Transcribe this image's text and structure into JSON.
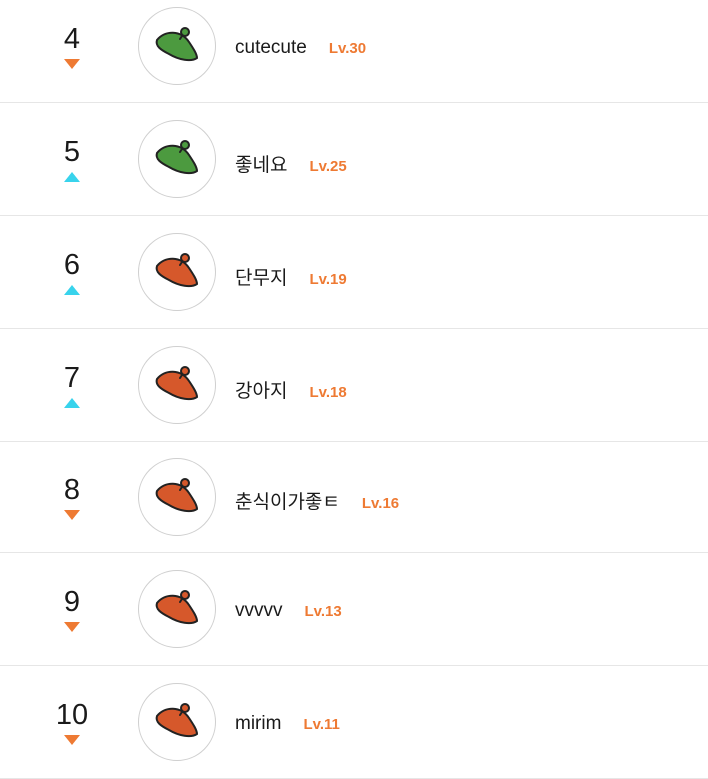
{
  "colors": {
    "down": "#ee7a33",
    "up": "#38d3ec",
    "level": "#ee7a33",
    "leaf_green": "#4c9a3f",
    "leaf_orange": "#d6582b"
  },
  "ranking": [
    {
      "rank": "4",
      "trend": "down",
      "name": "cutecute",
      "level": "Lv.30",
      "avatar_color": "green",
      "avatar_icon": "leaf-icon"
    },
    {
      "rank": "5",
      "trend": "up",
      "name": "좋네요",
      "level": "Lv.25",
      "avatar_color": "green",
      "avatar_icon": "leaf-icon"
    },
    {
      "rank": "6",
      "trend": "up",
      "name": "단무지",
      "level": "Lv.19",
      "avatar_color": "orange",
      "avatar_icon": "leaf-icon"
    },
    {
      "rank": "7",
      "trend": "up",
      "name": "강아지",
      "level": "Lv.18",
      "avatar_color": "orange",
      "avatar_icon": "leaf-icon"
    },
    {
      "rank": "8",
      "trend": "down",
      "name": "춘식이가좋ㅌ",
      "level": "Lv.16",
      "avatar_color": "orange",
      "avatar_icon": "leaf-icon"
    },
    {
      "rank": "9",
      "trend": "down",
      "name": "vvvvv",
      "level": "Lv.13",
      "avatar_color": "orange",
      "avatar_icon": "leaf-icon"
    },
    {
      "rank": "10",
      "trend": "down",
      "name": "mirim",
      "level": "Lv.11",
      "avatar_color": "orange",
      "avatar_icon": "leaf-icon"
    }
  ]
}
